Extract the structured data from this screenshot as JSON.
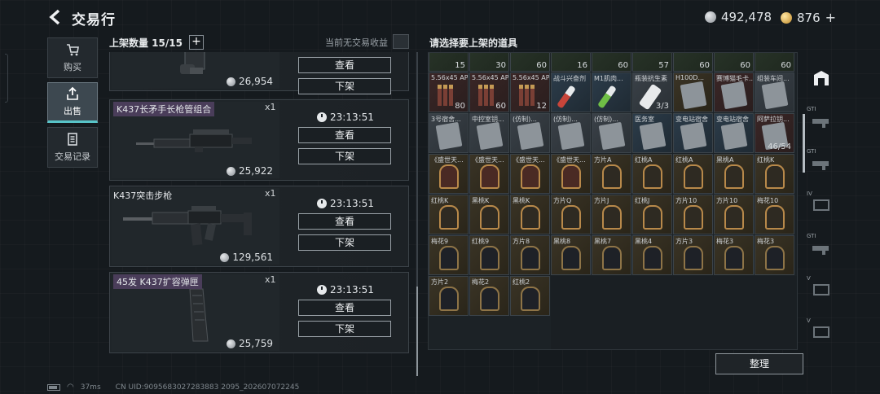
{
  "header": {
    "title": "交易行",
    "silver_amount": "492,478",
    "gold_amount": "876",
    "gold_plus": "+"
  },
  "sidebar": {
    "tabs": [
      {
        "label": "购买",
        "icon": "cart-icon",
        "active": false
      },
      {
        "label": "出售",
        "icon": "sell-icon",
        "active": true
      },
      {
        "label": "交易记录",
        "icon": "document-icon",
        "active": false
      }
    ]
  },
  "listings": {
    "count_label": "上架数量 15/15",
    "add_label": "+",
    "no_earnings": "当前无交易收益",
    "view_label": "查看",
    "delist_label": "下架",
    "items": [
      {
        "name": "",
        "qty": "",
        "price": "26,954",
        "timer": ""
      },
      {
        "name": "K437长矛手长枪管组合",
        "qty": "x1",
        "price": "25,922",
        "timer": "23:13:51"
      },
      {
        "name": "K437突击步枪",
        "qty": "x1",
        "price": "129,561",
        "timer": "23:13:51"
      },
      {
        "name": "45发 K437扩容弹匣",
        "qty": "x1",
        "price": "25,759",
        "timer": "23:13:51"
      }
    ]
  },
  "inventory": {
    "title": "请选择要上架的道具",
    "row0": [
      {
        "label": "",
        "count": "15",
        "style": "green"
      },
      {
        "label": "",
        "count": "30",
        "style": "green"
      },
      {
        "label": "",
        "count": "60",
        "style": "green"
      },
      {
        "label": "",
        "count": "16",
        "style": "green"
      },
      {
        "label": "",
        "count": "60",
        "style": "green"
      },
      {
        "label": "",
        "count": "57",
        "style": "green"
      },
      {
        "label": "",
        "count": "60",
        "style": "green"
      },
      {
        "label": "",
        "count": "60",
        "style": "green"
      },
      {
        "label": "",
        "count": "60",
        "style": "green"
      }
    ],
    "row1": [
      {
        "label": "5.56x45 AP",
        "count": "80",
        "style": "red",
        "kind": "ammo"
      },
      {
        "label": "5.56x45 AP",
        "count": "60",
        "style": "red",
        "kind": "ammo"
      },
      {
        "label": "5.56x45 AP",
        "count": "12",
        "style": "red",
        "kind": "ammo"
      },
      {
        "label": "战斗兴奋剂",
        "count": "",
        "style": "blue",
        "kind": "vial-red"
      },
      {
        "label": "M1肌肉...",
        "count": "",
        "style": "blue",
        "kind": "vial-green"
      },
      {
        "label": "瓶装抗生素",
        "count": "3/3",
        "style": "white",
        "kind": "pill"
      },
      {
        "label": "H100D...",
        "count": "",
        "style": "gold",
        "kind": "pic"
      },
      {
        "label": "赛博猫毛卡...",
        "count": "",
        "style": "red",
        "kind": "pic"
      },
      {
        "label": "组装车间...",
        "count": "",
        "style": "white",
        "kind": "pic"
      }
    ],
    "row2": [
      {
        "label": "3号宿舍...",
        "count": "",
        "style": "white",
        "kind": "pic"
      },
      {
        "label": "中控室钥...",
        "count": "",
        "style": "white",
        "kind": "pic"
      },
      {
        "label": "(仿制)...",
        "count": "",
        "style": "white",
        "kind": "pic"
      },
      {
        "label": "(仿制)...",
        "count": "",
        "style": "white",
        "kind": "pic"
      },
      {
        "label": "(仿制)...",
        "count": "",
        "style": "white",
        "kind": "pic"
      },
      {
        "label": "医务室",
        "count": "",
        "style": "blue",
        "kind": "pic"
      },
      {
        "label": "变电站宿舍",
        "count": "",
        "style": "blue",
        "kind": "pic"
      },
      {
        "label": "变电站宿舍",
        "count": "",
        "style": "blue",
        "kind": "pic"
      },
      {
        "label": "阿萨拉钥...",
        "count": "46/54",
        "style": "red",
        "kind": "pic"
      }
    ],
    "row3": [
      {
        "label": "《盛世天...",
        "kind": "card-red"
      },
      {
        "label": "《盛世天...",
        "kind": "card-red"
      },
      {
        "label": "《盛世天...",
        "kind": "card-red"
      },
      {
        "label": "《盛世天...",
        "kind": "card-red"
      },
      {
        "label": "方片A",
        "kind": "card"
      },
      {
        "label": "红桃A",
        "kind": "card"
      },
      {
        "label": "红桃A",
        "kind": "card"
      },
      {
        "label": "黑桃A",
        "kind": "card"
      },
      {
        "label": "红桃K",
        "kind": "card"
      }
    ],
    "row4": [
      {
        "label": "红桃K",
        "kind": "card"
      },
      {
        "label": "黑桃K",
        "kind": "card"
      },
      {
        "label": "黑桃K",
        "kind": "card"
      },
      {
        "label": "方片Q",
        "kind": "card"
      },
      {
        "label": "方片J",
        "kind": "card"
      },
      {
        "label": "红桃J",
        "kind": "card"
      },
      {
        "label": "方片10",
        "kind": "card"
      },
      {
        "label": "方片10",
        "kind": "card"
      },
      {
        "label": "梅花10",
        "kind": "card"
      }
    ],
    "row5": [
      {
        "label": "梅花9",
        "kind": "card-dark"
      },
      {
        "label": "红桃9",
        "kind": "card-dark"
      },
      {
        "label": "方片8",
        "kind": "card-dark"
      },
      {
        "label": "黑桃8",
        "kind": "card-dark"
      },
      {
        "label": "黑桃7",
        "kind": "card-dark"
      },
      {
        "label": "黑桃4",
        "kind": "card-dark"
      },
      {
        "label": "方片3",
        "kind": "card-dark"
      },
      {
        "label": "梅花3",
        "kind": "card-dark"
      },
      {
        "label": "梅花3",
        "kind": "card-dark"
      }
    ],
    "row6": [
      {
        "label": "方片2",
        "kind": "card-dark"
      },
      {
        "label": "梅花2",
        "kind": "card-dark"
      },
      {
        "label": "红桃2",
        "kind": "card-dark"
      }
    ],
    "sort_label": "整理"
  },
  "filters": [
    {
      "label": "",
      "icon": "all-items-icon"
    },
    {
      "label": "GTI",
      "icon": "gun-filter-icon"
    },
    {
      "label": "GTI",
      "icon": "gun-filter-icon"
    },
    {
      "label": "IV",
      "icon": "armor-filter-icon"
    },
    {
      "label": "GTI",
      "icon": "gun-filter-icon"
    },
    {
      "label": "V",
      "icon": "armor-filter-icon"
    },
    {
      "label": "V",
      "icon": "armor-filter-icon"
    }
  ],
  "footer": {
    "ping": "37ms",
    "uid": "CN UID:9095683027283883 2095_202607072245"
  }
}
